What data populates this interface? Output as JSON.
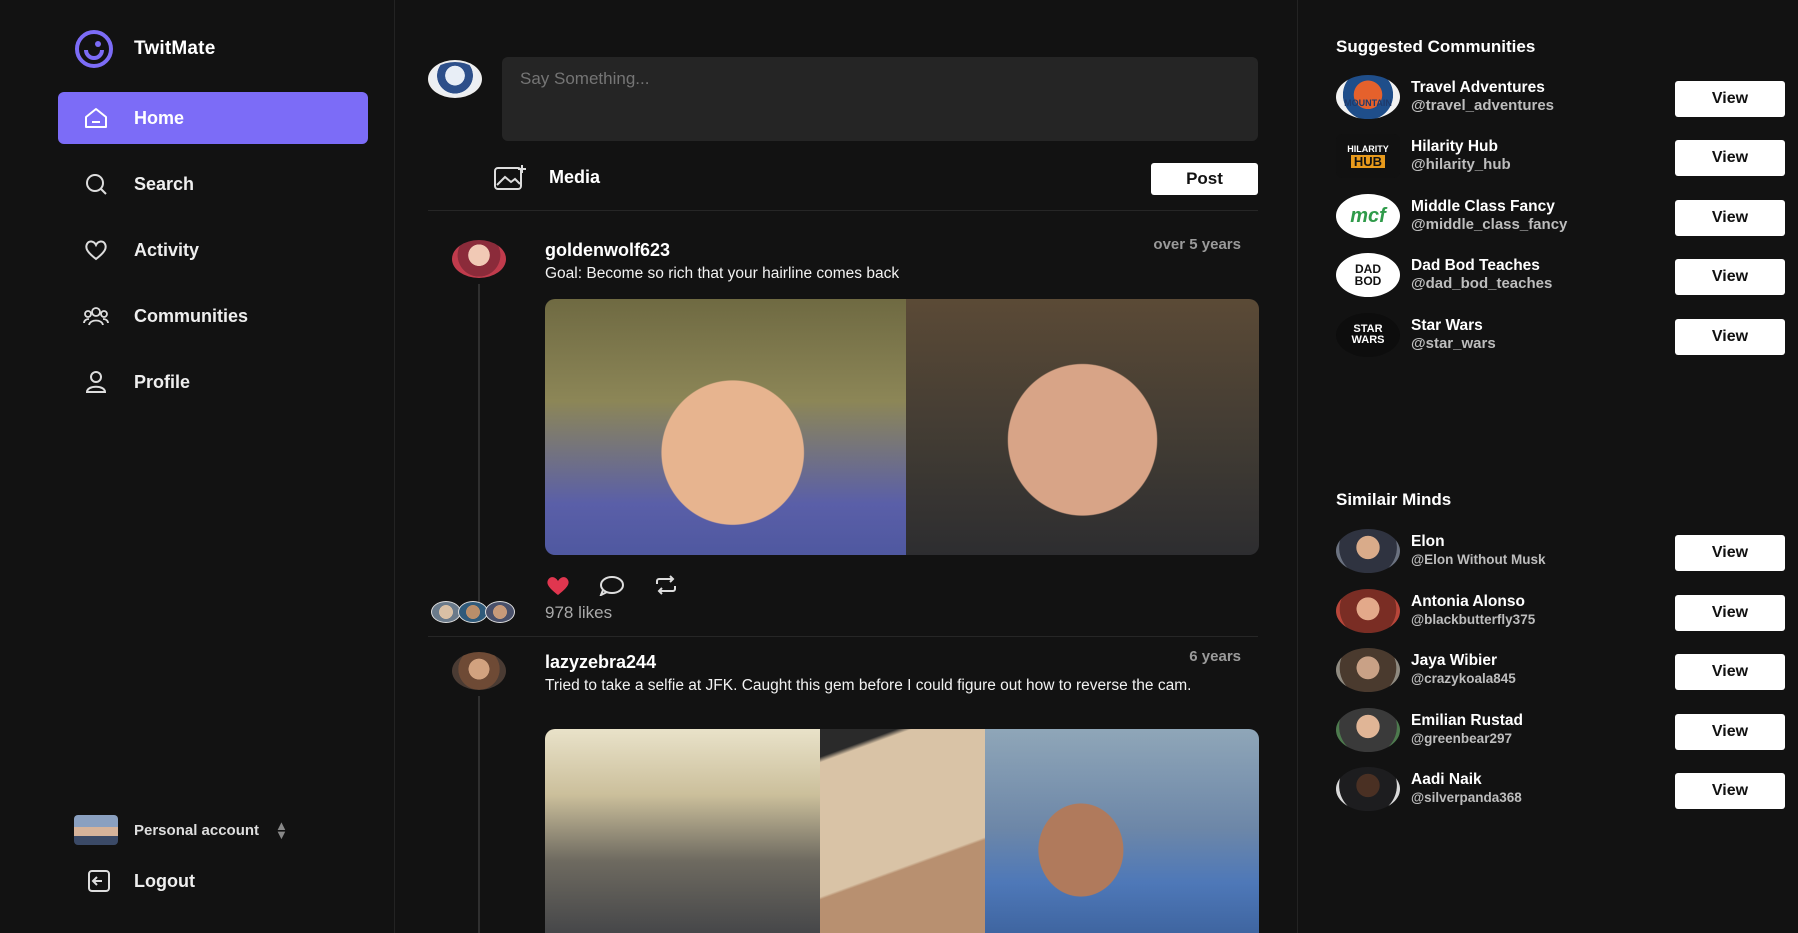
{
  "app": {
    "name": "TwitMate",
    "accent": "#7c6cf7"
  },
  "nav": [
    {
      "label": "Home",
      "icon": "home-icon",
      "active": true
    },
    {
      "label": "Search",
      "icon": "search-icon",
      "active": false
    },
    {
      "label": "Activity",
      "icon": "heart-icon",
      "active": false
    },
    {
      "label": "Communities",
      "icon": "communities-icon",
      "active": false
    },
    {
      "label": "Profile",
      "icon": "user-icon",
      "active": false
    }
  ],
  "account": {
    "label": "Personal account",
    "logout_label": "Logout"
  },
  "composer": {
    "placeholder": "Say Something...",
    "media_label": "Media",
    "post_label": "Post"
  },
  "posts": [
    {
      "username": "goldenwolf623",
      "time": "over 5 years",
      "text": "Goal: Become so rich that your hairline comes back",
      "likes": "978 likes",
      "liked": true
    },
    {
      "username": "lazyzebra244",
      "time": "6 years",
      "text": "Tried to take a selfie at JFK. Caught this gem before I could figure out how to reverse the cam."
    }
  ],
  "suggested": {
    "title": "Suggested Communities",
    "items": [
      {
        "name": "Travel Adventures",
        "handle": "@travel_adventures",
        "button": "View"
      },
      {
        "name": "Hilarity Hub",
        "handle": "@hilarity_hub",
        "button": "View"
      },
      {
        "name": "Middle Class Fancy",
        "handle": "@middle_class_fancy",
        "button": "View"
      },
      {
        "name": "Dad Bod Teaches",
        "handle": "@dad_bod_teaches",
        "button": "View"
      },
      {
        "name": "Star Wars",
        "handle": "@star_wars",
        "button": "View"
      }
    ]
  },
  "similar": {
    "title": "Similair Minds",
    "items": [
      {
        "name": "Elon",
        "handle": "@Elon Without Musk",
        "button": "View"
      },
      {
        "name": "Antonia Alonso",
        "handle": "@blackbutterfly375",
        "button": "View"
      },
      {
        "name": "Jaya Wibier",
        "handle": "@crazykoala845",
        "button": "View"
      },
      {
        "name": "Emilian Rustad",
        "handle": "@greenbear297",
        "button": "View"
      },
      {
        "name": "Aadi Naik",
        "handle": "@silverpanda368",
        "button": "View"
      }
    ]
  },
  "logos": {
    "mountain_text": "MOUNTAIN",
    "hilarity_top": "HILARITY",
    "hilarity_bottom": "HUB",
    "mcf": "mcf",
    "dadbod": "DAD BOD",
    "starwars": "STAR WARS"
  }
}
